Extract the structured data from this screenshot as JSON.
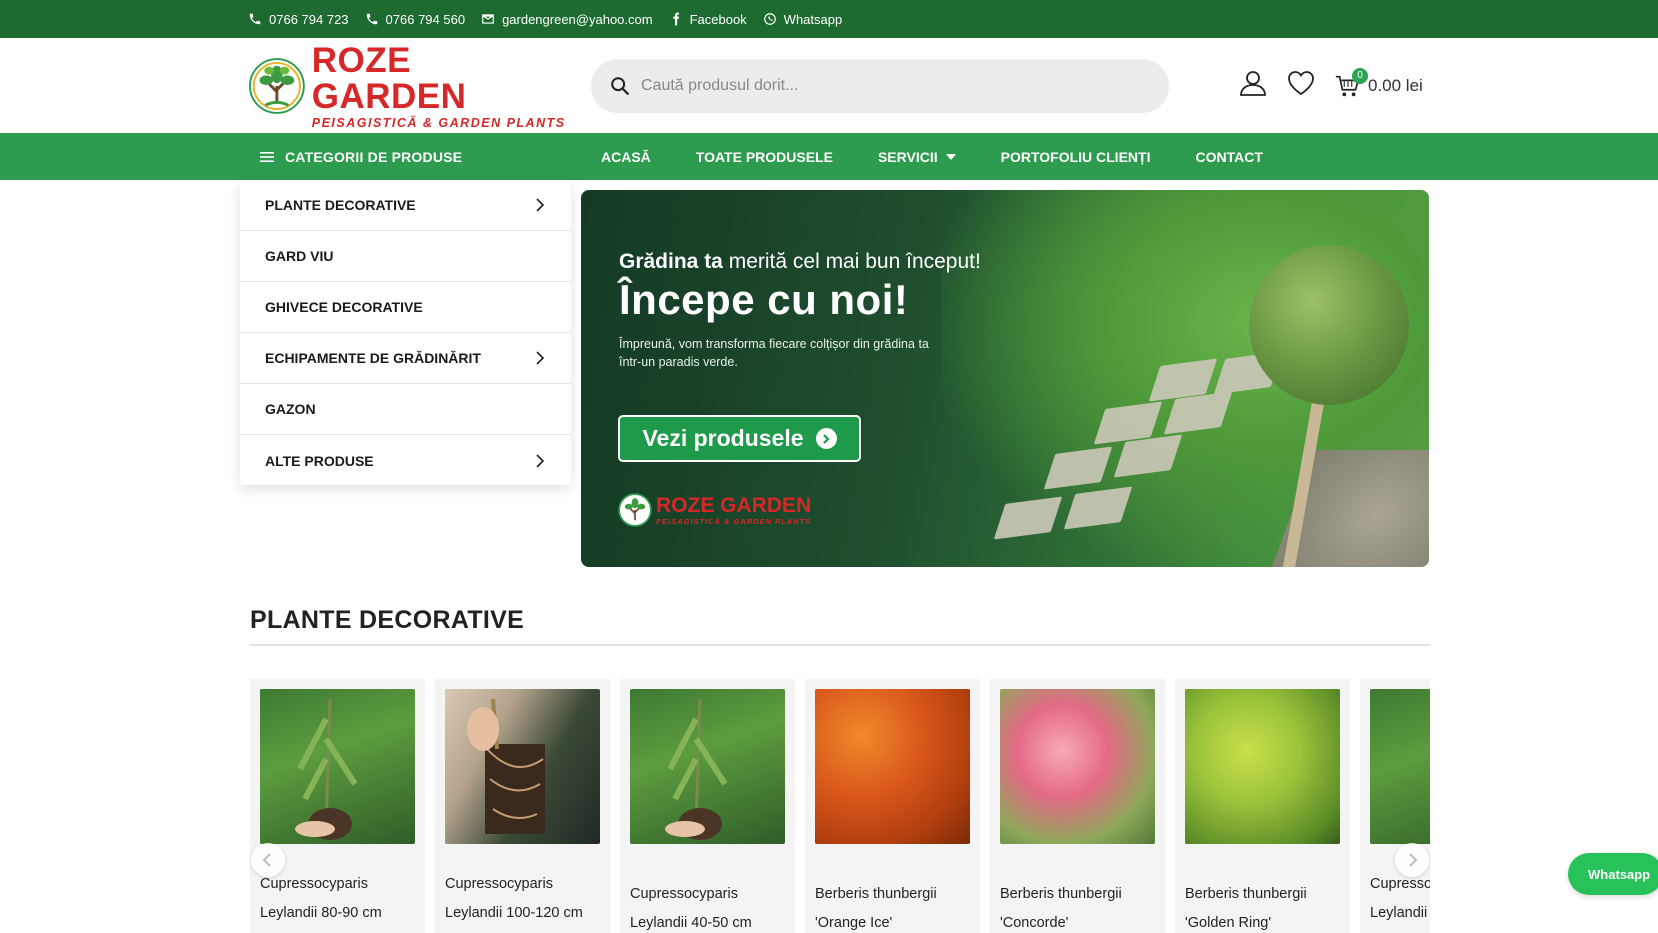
{
  "topbar": {
    "phone1": "0766 794 723",
    "phone2": "0766 794 560",
    "email": "gardengreen@yahoo.com",
    "facebook": "Facebook",
    "whatsapp": "Whatsapp",
    "icons": [
      "phone-icon",
      "phone-icon",
      "mail-icon",
      "facebook-icon",
      "whatsapp-icon"
    ]
  },
  "header": {
    "logo_name": "ROZE GARDEN",
    "logo_tagline": "PEISAGISTICĂ & GARDEN PLANTS",
    "search_placeholder": "Caută produsul dorit...",
    "cart_count": "0",
    "cart_total": "0.00 lei"
  },
  "nav": {
    "categories_label": "CATEGORII DE PRODUSE",
    "links": [
      "ACASĂ",
      "TOATE PRODUSELE",
      "SERVICII",
      "PORTOFOLIU CLIENȚI",
      "CONTACT"
    ]
  },
  "category_menu": [
    {
      "label": "PLANTE DECORATIVE",
      "has_submenu": true
    },
    {
      "label": "GARD VIU",
      "has_submenu": false
    },
    {
      "label": "GHIVECE DECORATIVE",
      "has_submenu": false
    },
    {
      "label": "ECHIPAMENTE DE GRĂDINĂRIT",
      "has_submenu": true
    },
    {
      "label": "GAZON",
      "has_submenu": false
    },
    {
      "label": "ALTE PRODUSE",
      "has_submenu": true
    }
  ],
  "hero": {
    "line1_bold": "Grădina ta",
    "line1_rest": " merită cel mai bun început!",
    "headline": "Începe cu noi!",
    "body": "Împreună, vom transforma fiecare colțișor din grădina ta într-un paradis verde.",
    "button": "Vezi produsele",
    "logo_name": "ROZE GARDEN",
    "logo_tagline": "PEISAGISTICĂ & GARDEN PLANTS"
  },
  "section": {
    "title": "PLANTE DECORATIVE"
  },
  "products": [
    {
      "line1": "Cupressocyparis",
      "line2": "Leylandii 80-90 cm"
    },
    {
      "line1": "Cupressocyparis",
      "line2": "Leylandii 100-120 cm"
    },
    {
      "line1": "Cupressocyparis",
      "line2": "Leylandii 40-50 cm"
    },
    {
      "line1": "Berberis thunbergii",
      "line2": "'Orange Ice'"
    },
    {
      "line1": "Berberis thunbergii",
      "line2": "'Concorde'"
    },
    {
      "line1": "Berberis thunbergii",
      "line2": "'Golden Ring'"
    },
    {
      "line1": "Cupressocyparis",
      "line2": "Leylandii"
    }
  ],
  "floating": {
    "whatsapp_label": "Whatsapp"
  },
  "colors": {
    "topbar": "#1e6b32",
    "nav": "#2e9c4f",
    "brand_red": "#d62828",
    "cta": "#1d9a4a",
    "whatsapp": "#27c25a"
  }
}
